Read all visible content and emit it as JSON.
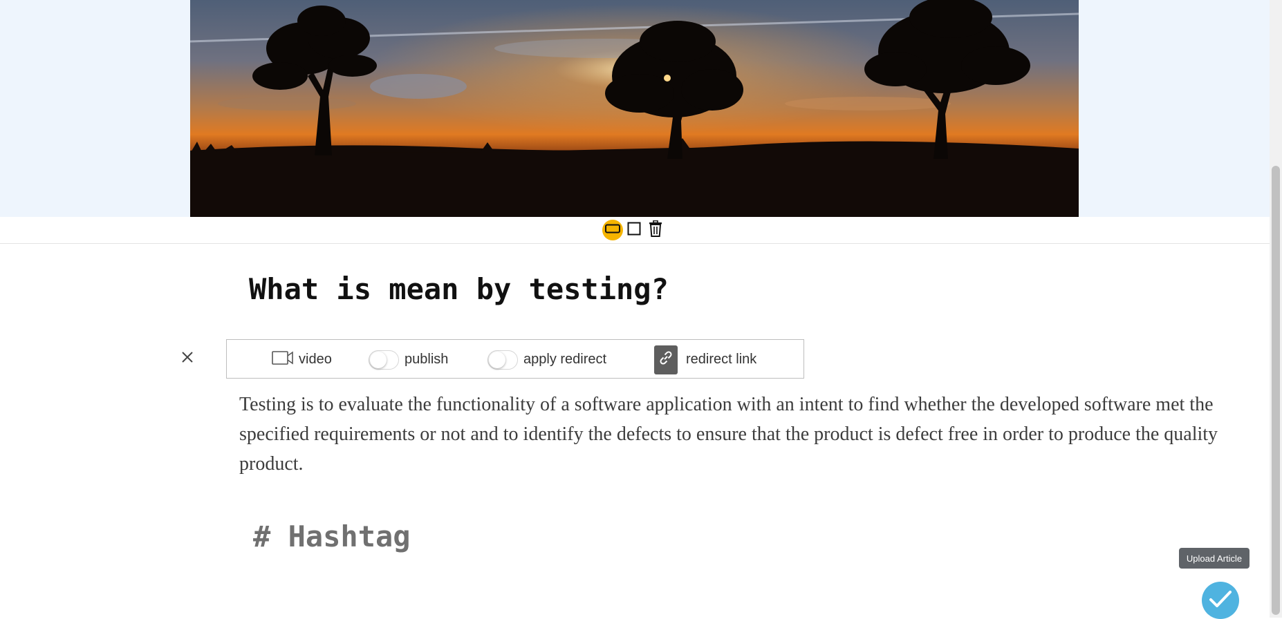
{
  "hero": {
    "image": "silhouette-trees-sunset-photo"
  },
  "image_tools": {
    "wide_icon": "wide-layout-icon",
    "square_icon": "square-layout-icon",
    "delete_icon": "trash-icon",
    "active_color": "#f5b400"
  },
  "article": {
    "title": "What is mean by testing?",
    "body": "Testing is to evaluate the functionality of a software application with an intent to find whether the developed software met the specified requirements or not and to identify the defects to ensure that the product is defect free in order to produce the quality product.",
    "hashtag_placeholder": "# Hashtag"
  },
  "toolbar": {
    "close_icon": "close-icon",
    "video_label": "video",
    "publish_label": "publish",
    "publish_on": false,
    "apply_redirect_label": "apply redirect",
    "apply_redirect_on": false,
    "redirect_link_label": "redirect link"
  },
  "upload": {
    "tooltip": "Upload Article",
    "icon": "check-icon",
    "color": "#4fb3e0"
  }
}
